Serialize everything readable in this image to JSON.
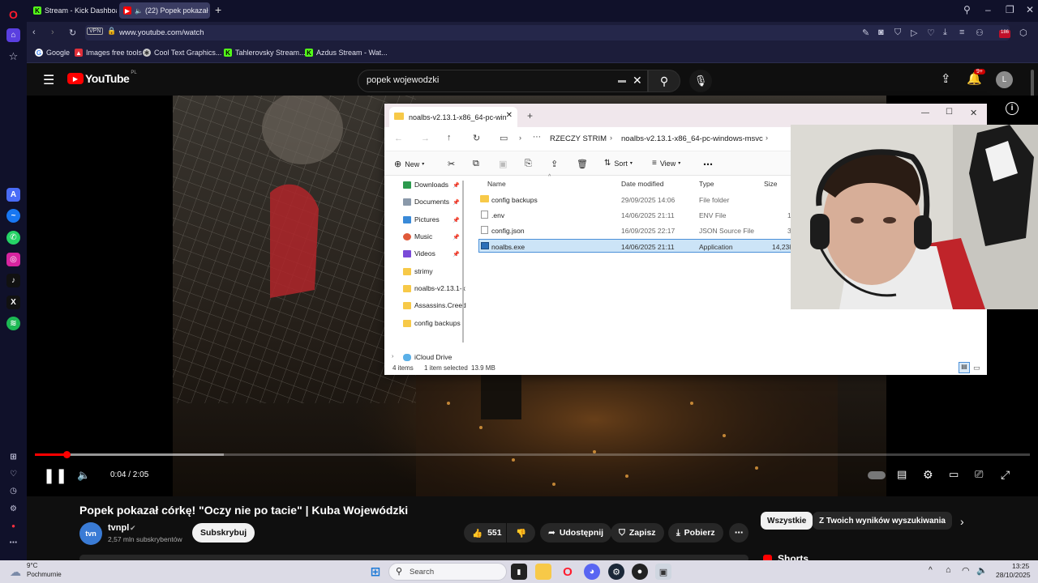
{
  "browser": {
    "tabs": [
      {
        "title": "Stream - Kick Dashboard"
      },
      {
        "title": "(22) Popek pokazał có"
      }
    ],
    "url": "www.youtube.com/watch",
    "vpn_label": "VPN",
    "bookmarks": [
      {
        "label": "Google"
      },
      {
        "label": "Images free tools"
      },
      {
        "label": "Cool Text Graphics..."
      },
      {
        "label": "Tahlerovsky Stream..."
      },
      {
        "label": "Azdus Stream - Wat..."
      }
    ],
    "extension_badge": "186"
  },
  "youtube": {
    "logo_text": "YouTube",
    "logo_region": "PL",
    "search_query": "popek wojewodzki",
    "notif_count": "9+",
    "avatar_letter": "L",
    "player": {
      "time": "0:04 / 2:05",
      "progress": 0.032,
      "buffered": 0.19
    },
    "video_title": "Popek pokazał córkę! \"Oczy nie po tacie\" | Kuba Wojewódzki",
    "channel_name": "tvnpl",
    "channel_logo": "tvn",
    "subscribers": "2,57 mln subskrybentów",
    "subscribe_label": "Subskrybuj",
    "likes": "551",
    "share_label": "Udostępnij",
    "save_label": "Zapisz",
    "download_label": "Pobierz",
    "chips": [
      "Wszystkie",
      "Z Twoich wyników wyszukiwania"
    ],
    "shorts_label": "Shorts"
  },
  "explorer": {
    "tab_title": "noalbs-v2.13.1-x86_64-pc-win",
    "breadcrumb": [
      "RZECZY STRIM",
      "noalbs-v2.13.1-x86_64-pc-windows-msvc"
    ],
    "toolbar": {
      "new": "New",
      "sort": "Sort",
      "view": "View"
    },
    "nav_items": [
      {
        "label": "Downloads",
        "pinned": true
      },
      {
        "label": "Documents",
        "pinned": true
      },
      {
        "label": "Pictures",
        "pinned": true
      },
      {
        "label": "Music",
        "pinned": true
      },
      {
        "label": "Videos",
        "pinned": true
      },
      {
        "label": "strimy",
        "pinned": false
      },
      {
        "label": "noalbs-v2.13.1-x",
        "pinned": false
      },
      {
        "label": "Assassins.Creed",
        "pinned": false
      },
      {
        "label": "config backups",
        "pinned": false
      },
      {
        "label": "iCloud Drive",
        "pinned": false
      }
    ],
    "columns": [
      "Name",
      "Date modified",
      "Type",
      "Size"
    ],
    "files": [
      {
        "name": "config backups",
        "date": "29/09/2025 14:06",
        "type": "File folder",
        "size": "",
        "selected": false
      },
      {
        "name": ".env",
        "date": "14/06/2025 21:11",
        "type": "ENV File",
        "size": "1",
        "selected": false
      },
      {
        "name": "config.json",
        "date": "16/09/2025 22:17",
        "type": "JSON Source File",
        "size": "3",
        "selected": false
      },
      {
        "name": "noalbs.exe",
        "date": "14/06/2025 21:11",
        "type": "Application",
        "size": "14,238",
        "selected": true
      }
    ],
    "status": {
      "items": "4 items",
      "selected": "1 item selected",
      "size": "13.9 MB"
    }
  },
  "taskbar": {
    "weather_temp": "9°C",
    "weather_desc": "Pochmurnie",
    "search_placeholder": "Search",
    "time": "13:25",
    "date": "28/10/2025"
  }
}
